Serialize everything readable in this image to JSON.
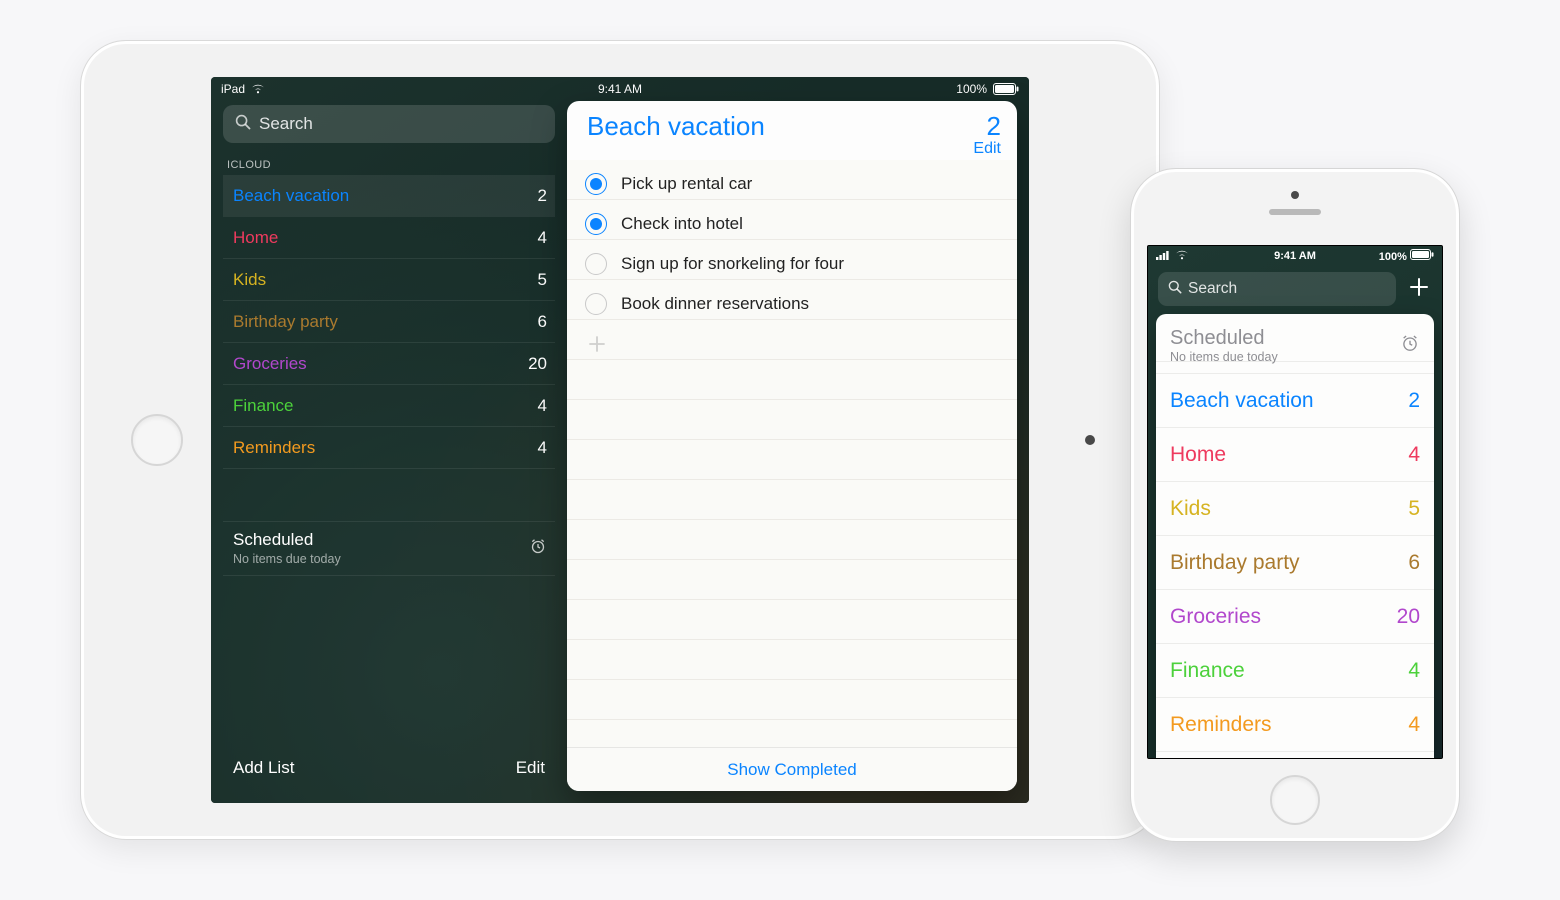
{
  "status": {
    "device_label": "iPad",
    "time": "9:41 AM",
    "battery_text": "100%"
  },
  "search_placeholder": "Search",
  "sidebar": {
    "section_label": "ICLOUD",
    "lists": [
      {
        "name": "Beach vacation",
        "count": "2",
        "color": "c-blue"
      },
      {
        "name": "Home",
        "count": "4",
        "color": "c-red"
      },
      {
        "name": "Kids",
        "count": "5",
        "color": "c-yellow"
      },
      {
        "name": "Birthday party",
        "count": "6",
        "color": "c-brown"
      },
      {
        "name": "Groceries",
        "count": "20",
        "color": "c-purple"
      },
      {
        "name": "Finance",
        "count": "4",
        "color": "c-green"
      },
      {
        "name": "Reminders",
        "count": "4",
        "color": "c-orange"
      }
    ],
    "scheduled": {
      "title": "Scheduled",
      "subtitle": "No items due today"
    },
    "footer": {
      "add_list": "Add List",
      "edit": "Edit"
    }
  },
  "detail": {
    "title": "Beach vacation",
    "count": "2",
    "edit": "Edit",
    "accent": "#0a84ff",
    "tasks": [
      {
        "label": "Pick up rental car",
        "done": true
      },
      {
        "label": "Check into hotel",
        "done": true
      },
      {
        "label": "Sign up for snorkeling for four",
        "done": false
      },
      {
        "label": "Book dinner reservations",
        "done": false
      }
    ],
    "show_completed": "Show Completed"
  },
  "phone": {
    "time": "9:41 AM",
    "battery_text": "100%",
    "search_placeholder": "Search",
    "scheduled": {
      "title": "Scheduled",
      "subtitle": "No items due today"
    },
    "lists": [
      {
        "name": "Beach vacation",
        "count": "2",
        "color": "c-blue"
      },
      {
        "name": "Home",
        "count": "4",
        "color": "c-red"
      },
      {
        "name": "Kids",
        "count": "5",
        "color": "c-yellow"
      },
      {
        "name": "Birthday party",
        "count": "6",
        "color": "c-brown"
      },
      {
        "name": "Groceries",
        "count": "20",
        "color": "c-purple"
      },
      {
        "name": "Finance",
        "count": "4",
        "color": "c-green"
      },
      {
        "name": "Reminders",
        "count": "4",
        "color": "c-orange"
      }
    ]
  }
}
